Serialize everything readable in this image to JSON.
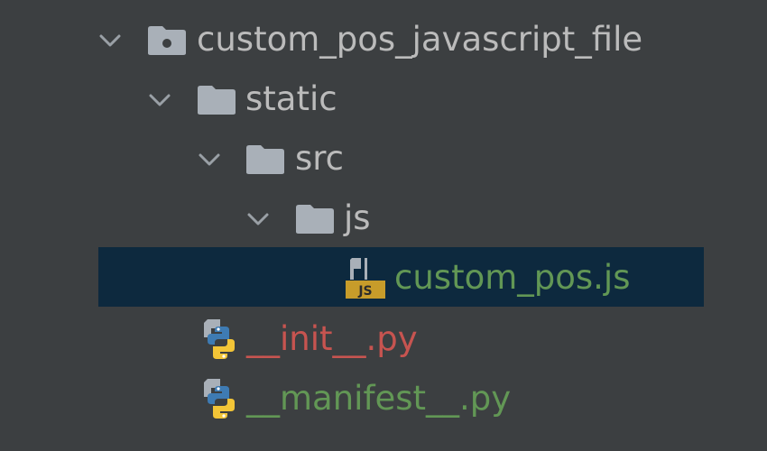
{
  "tree": {
    "items": [
      {
        "label": "custom_pos_javascript_file",
        "type": "module-folder",
        "expanded": true,
        "icon": "module-folder-icon"
      },
      {
        "label": "static",
        "type": "folder",
        "expanded": true,
        "icon": "folder-icon"
      },
      {
        "label": "src",
        "type": "folder",
        "expanded": true,
        "icon": "folder-icon"
      },
      {
        "label": "js",
        "type": "folder",
        "expanded": true,
        "icon": "folder-icon"
      },
      {
        "label": "custom_pos.js",
        "type": "file",
        "selected": true,
        "icon": "javascript-file-icon",
        "icon_text": "JS"
      },
      {
        "label": "__init__.py",
        "type": "file",
        "icon": "python-file-icon"
      },
      {
        "label": "__manifest__.py",
        "type": "file",
        "icon": "python-file-icon"
      }
    ]
  },
  "colors": {
    "background": "#3c3f41",
    "selection": "#0d293e",
    "default_text": "#bbbbbb",
    "added_file_text": "#629755",
    "unversioned_file_text": "#c75450",
    "folder_icon": "#a9b0b8",
    "chevron": "#9aa0a6",
    "js_badge": "#c79c2a",
    "python_blue": "#3e7bb3",
    "python_yellow": "#f3c537"
  }
}
